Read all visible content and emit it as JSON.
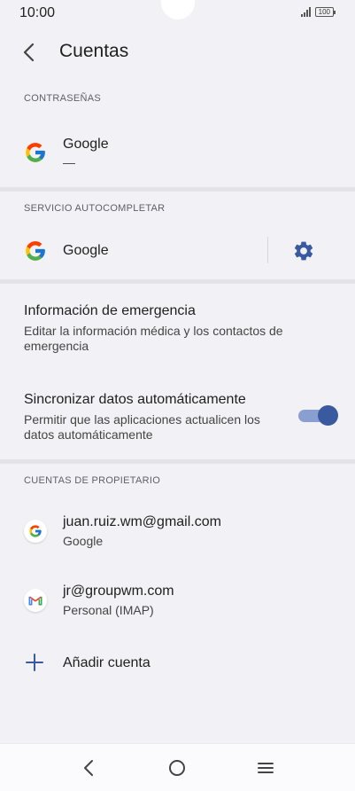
{
  "status_bar": {
    "time": "10:00",
    "battery": "100"
  },
  "header": {
    "title": "Cuentas"
  },
  "passwords": {
    "section_label": "CONTRASEÑAS",
    "provider_name": "Google",
    "provider_sub": "—"
  },
  "autofill": {
    "section_label": "SERVICIO AUTOCOMPLETAR",
    "provider_name": "Google"
  },
  "emergency": {
    "title": "Información de emergencia",
    "subtitle": "Editar la información médica y los contactos de emergencia"
  },
  "sync": {
    "title": "Sincronizar datos automáticamente",
    "subtitle": "Permitir que las aplicaciones actualicen los datos automáticamente",
    "enabled": true
  },
  "owner_accounts": {
    "section_label": "CUENTAS DE PROPIETARIO",
    "accounts": [
      {
        "email": "juan.ruiz.wm@gmail.com",
        "type": "Google",
        "icon": "google-icon"
      },
      {
        "email": "jr@groupwm.com",
        "type": "Personal (IMAP)",
        "icon": "gmail-icon"
      }
    ],
    "add_label": "Añadir cuenta"
  },
  "colors": {
    "background": "#f2f1f6",
    "toggle_thumb": "#3a5a9f",
    "toggle_track": "#8a9fd1",
    "icon_blue": "#3a5a9f"
  }
}
